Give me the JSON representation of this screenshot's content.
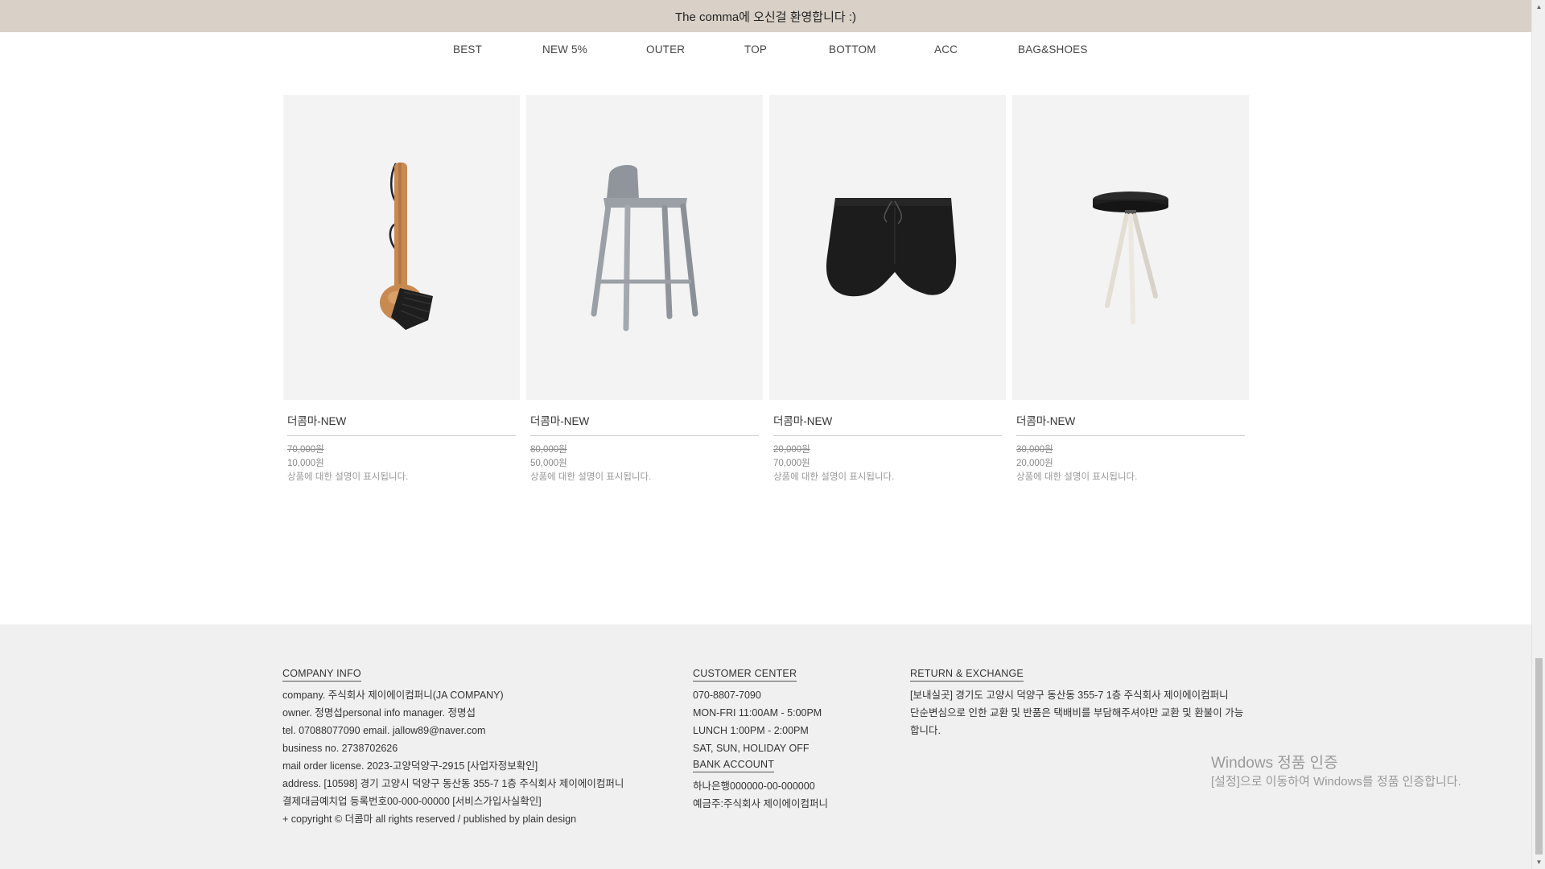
{
  "topbar": {
    "text": "The comma에 오신걸 환영합니다 :)"
  },
  "nav": {
    "items": [
      "BEST",
      "NEW 5%",
      "OUTER",
      "TOP",
      "BOTTOM",
      "ACC",
      "BAG&SHOES"
    ]
  },
  "products": [
    {
      "image": "wooden-brush-image",
      "name": "더콤마-NEW",
      "old_price": "70,000원",
      "price": "10,000원",
      "description": "상품에 대한 설명이 표시됩니다."
    },
    {
      "image": "gray-bar-stool-image",
      "name": "더콤마-NEW",
      "old_price": "80,000원",
      "price": "50,000원",
      "description": "상품에 대한 설명이 표시됩니다."
    },
    {
      "image": "black-shorts-image",
      "name": "더콤마-NEW",
      "old_price": "20,000원",
      "price": "70,000원",
      "description": "상품에 대한 설명이 표시됩니다."
    },
    {
      "image": "round-stool-image",
      "name": "더콤마-NEW",
      "old_price": "30,000원",
      "price": "20,000원",
      "description": "상품에 대한 설명이 표시됩니다."
    }
  ],
  "footer": {
    "company": {
      "title": "COMPANY INFO",
      "lines": [
        "company. 주식회사 제이에이컴퍼니(JA COMPANY)",
        "owner. 정명섭personal info manager. 정명섭",
        "tel. 07088077090 email. jallow89@naver.com",
        "business no. 2738702626",
        "mail order license. 2023-고양덕양구-2915 [사업자정보확인]",
        "address. [10598] 경기 고양시 덕양구 동산동 355-7 1층 주식회사 제이에이컴퍼니",
        "결제대금예치업 등록번호00-000-00000 [서비스가입사실확인]",
        "+ copyright © 더콤마 all rights reserved / published by plain design"
      ]
    },
    "customer": {
      "title": "CUSTOMER CENTER",
      "lines": [
        "070-8807-7090",
        "MON-FRI 11:00AM - 5:00PM",
        "LUNCH 1:00PM - 2:00PM",
        "SAT, SUN, HOLIDAY OFF"
      ]
    },
    "bank": {
      "title": "BANK ACCOUNT",
      "lines": [
        "하나은행000000-00-000000",
        "예금주:주식회사 제이에이컴퍼니"
      ]
    },
    "return": {
      "title": "RETURN & EXCHANGE",
      "lines": [
        "[보내실곳] 경기도 고양시 덕양구 동산동 355-7 1층 주식회사 제이에이컴퍼니",
        "단순변심으로 인한 교환 및 반품은 택배비를 부담해주셔야만 교환 및 환불이 가능합니다."
      ]
    }
  },
  "watermark": {
    "line1": "Windows 정품 인증",
    "line2": "[설정]으로 이동하여 Windows를 정품 인증합니다."
  },
  "colors": {
    "topbar": "#d9d1c8",
    "footer": "#f0f0f0",
    "thumb_bg": "#f3f3f3"
  }
}
